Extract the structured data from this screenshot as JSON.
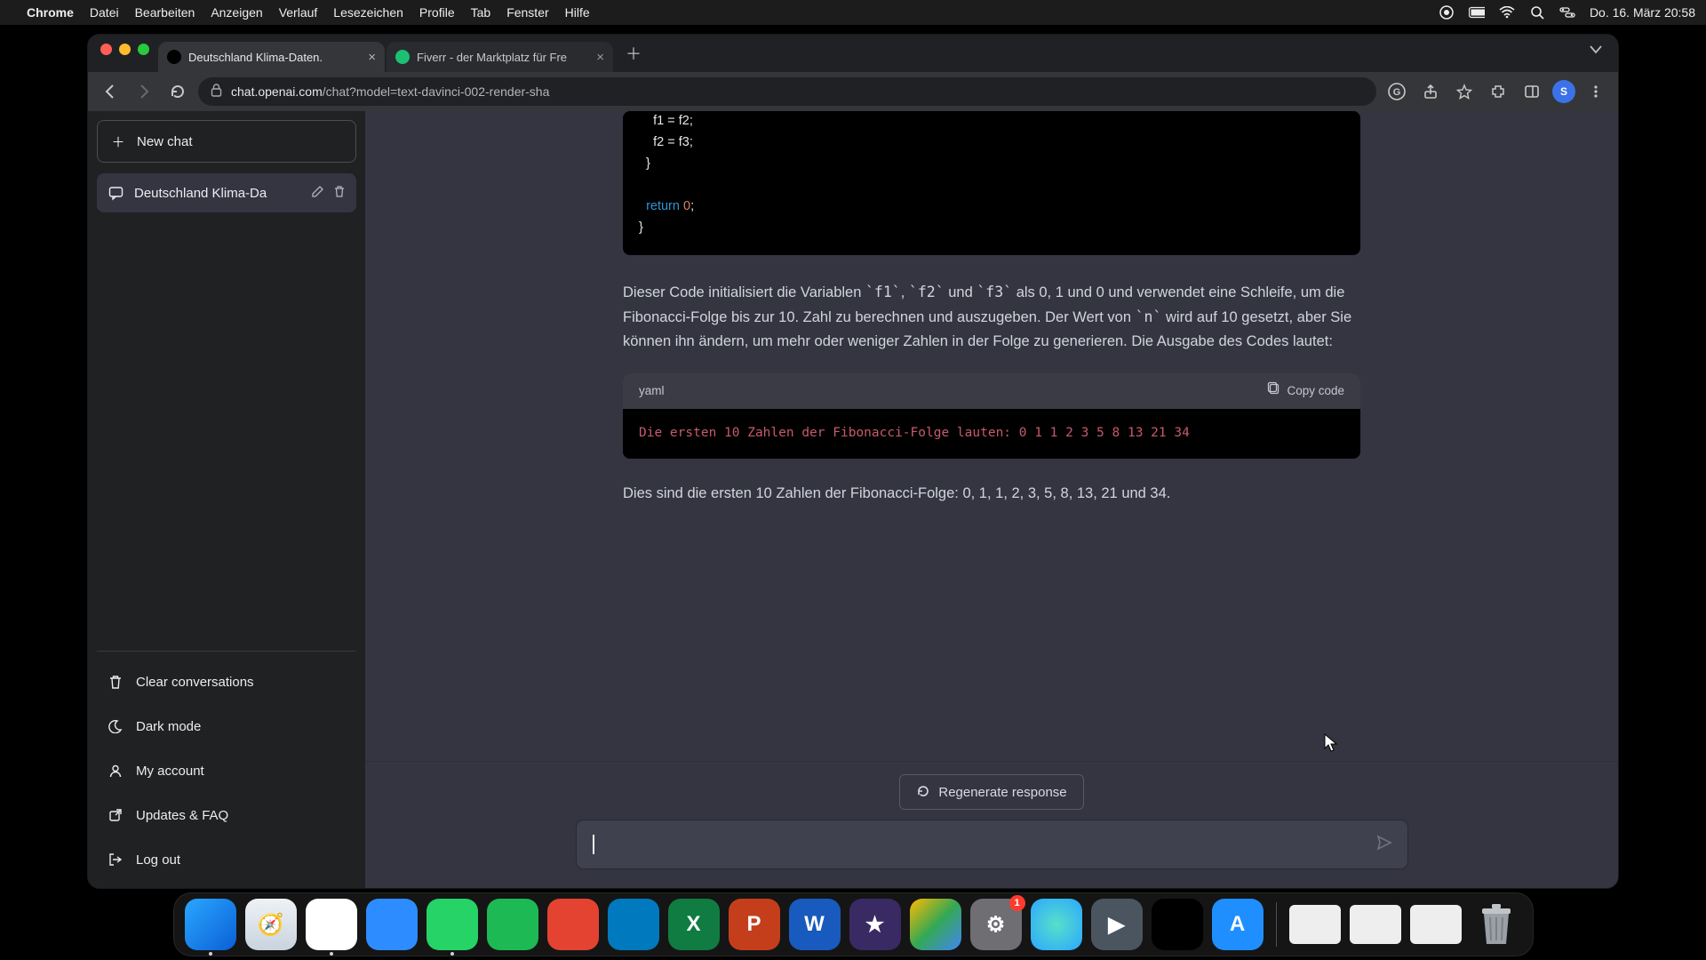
{
  "menubar": {
    "app": "Chrome",
    "items": [
      "Datei",
      "Bearbeiten",
      "Anzeigen",
      "Verlauf",
      "Lesezeichen",
      "Profile",
      "Tab",
      "Fenster",
      "Hilfe"
    ],
    "clock": "Do. 16. März 20:58"
  },
  "browser": {
    "tabs": [
      {
        "title": "Deutschland Klima-Daten.",
        "active": true,
        "favicon": "#000000"
      },
      {
        "title": "Fiverr - der Marktplatz für Fre",
        "active": false,
        "favicon": "#1dbf73"
      }
    ],
    "url_host": "chat.openai.com",
    "url_path": "/chat?model=text-davinci-002-render-sha",
    "avatar_letter": "S"
  },
  "sidebar": {
    "newchat": "New chat",
    "conversations": [
      {
        "title": "Deutschland Klima-Da"
      }
    ],
    "items": [
      {
        "icon": "trash",
        "label": "Clear conversations"
      },
      {
        "icon": "moon",
        "label": "Dark mode"
      },
      {
        "icon": "user",
        "label": "My account"
      },
      {
        "icon": "link",
        "label": "Updates & FAQ"
      },
      {
        "icon": "logout",
        "label": "Log out"
      }
    ]
  },
  "chat": {
    "code_lines": [
      "    f1 = f2;",
      "    f2 = f3;",
      "  }",
      "",
      "  return 0;",
      "}"
    ],
    "para1": "Dieser Code initialisiert die Variablen `f1`, `f2` und `f3` als 0, 1 und 0 und verwendet eine Schleife, um die Fibonacci-Folge bis zur 10. Zahl zu berechnen und auszugeben. Der Wert von `n` wird auf 10 gesetzt, aber Sie können ihn ändern, um mehr oder weniger Zahlen in der Folge zu generieren. Die Ausgabe des Codes lautet:",
    "yaml_lang": "yaml",
    "copy_label": "Copy code",
    "yaml_output": "Die ersten 10 Zahlen der Fibonacci-Folge lauten: 0 1 1 2 3 5 8 13 21 34",
    "para2": "Dies sind die ersten 10 Zahlen der Fibonacci-Folge: 0, 1, 1, 2, 3, 5, 8, 13, 21 und 34.",
    "regenerate": "Regenerate response",
    "input_placeholder": ""
  },
  "dock": {
    "apps": [
      {
        "name": "finder",
        "bg": "linear-gradient(135deg,#2aa7ff,#0a5fd6)",
        "glyph": "",
        "running": true
      },
      {
        "name": "safari",
        "bg": "linear-gradient(180deg,#eef2f6,#c9d3de)",
        "glyph": "🧭",
        "running": false
      },
      {
        "name": "chrome",
        "bg": "#fff",
        "glyph": "",
        "running": true
      },
      {
        "name": "zoom",
        "bg": "#2d8cff",
        "glyph": "",
        "running": false
      },
      {
        "name": "whatsapp",
        "bg": "#25d366",
        "glyph": "",
        "running": true
      },
      {
        "name": "spotify",
        "bg": "#1db954",
        "glyph": "",
        "running": false
      },
      {
        "name": "todoist",
        "bg": "#e44332",
        "glyph": "",
        "running": false
      },
      {
        "name": "trello",
        "bg": "#0079bf",
        "glyph": "",
        "running": false
      },
      {
        "name": "excel",
        "bg": "#107c41",
        "glyph": "X",
        "running": false
      },
      {
        "name": "powerpoint",
        "bg": "#c43e1c",
        "glyph": "P",
        "running": false
      },
      {
        "name": "word",
        "bg": "#185abd",
        "glyph": "W",
        "running": false
      },
      {
        "name": "imovie",
        "bg": "#3a2a63",
        "glyph": "★",
        "running": false
      },
      {
        "name": "drive",
        "bg": "linear-gradient(135deg,#ffba00,#34a853 50%,#4285f4)",
        "glyph": "",
        "running": false
      },
      {
        "name": "settings",
        "bg": "#6e6e73",
        "glyph": "⚙",
        "running": false,
        "badge": "1"
      },
      {
        "name": "siri",
        "bg": "radial-gradient(circle,#57e0c9,#2aa7ff)",
        "glyph": "",
        "running": false
      },
      {
        "name": "quicktime",
        "bg": "#4a5560",
        "glyph": "▶",
        "running": false
      },
      {
        "name": "voice-memos",
        "bg": "#000",
        "glyph": "",
        "running": false
      },
      {
        "name": "appstore",
        "bg": "#1f8fff",
        "glyph": "A",
        "running": false
      }
    ],
    "tiles": 3
  }
}
